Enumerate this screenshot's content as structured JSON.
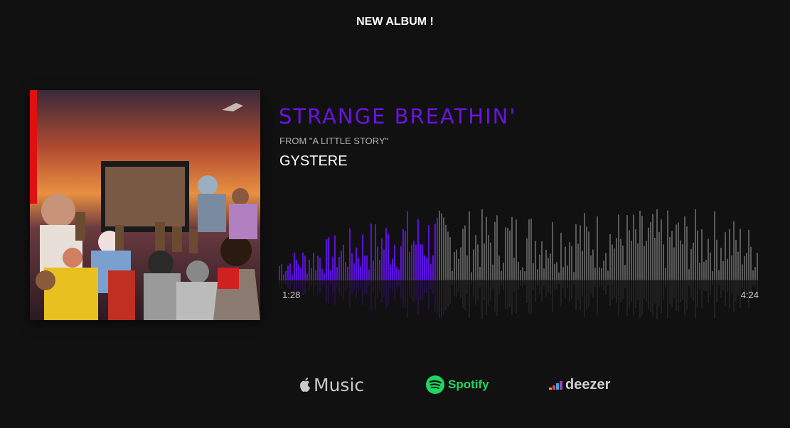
{
  "header": {
    "title": "NEW ALBUM !"
  },
  "track": {
    "title": "STRANGE BREATHIN'",
    "from": "FROM \"A LITTLE STORY\"",
    "artist": "GYSTERE"
  },
  "player": {
    "elapsed": "1:28",
    "total": "4:24",
    "progress": 0.333,
    "played_color": "#5b12d6",
    "unplayed_color": "#5a5a5a"
  },
  "links": {
    "apple_music": "Music",
    "spotify": "Spotify",
    "deezer": "deezer"
  },
  "colors": {
    "accent": "#6a14e0",
    "background": "#121112",
    "spotify_green": "#1ed760"
  }
}
